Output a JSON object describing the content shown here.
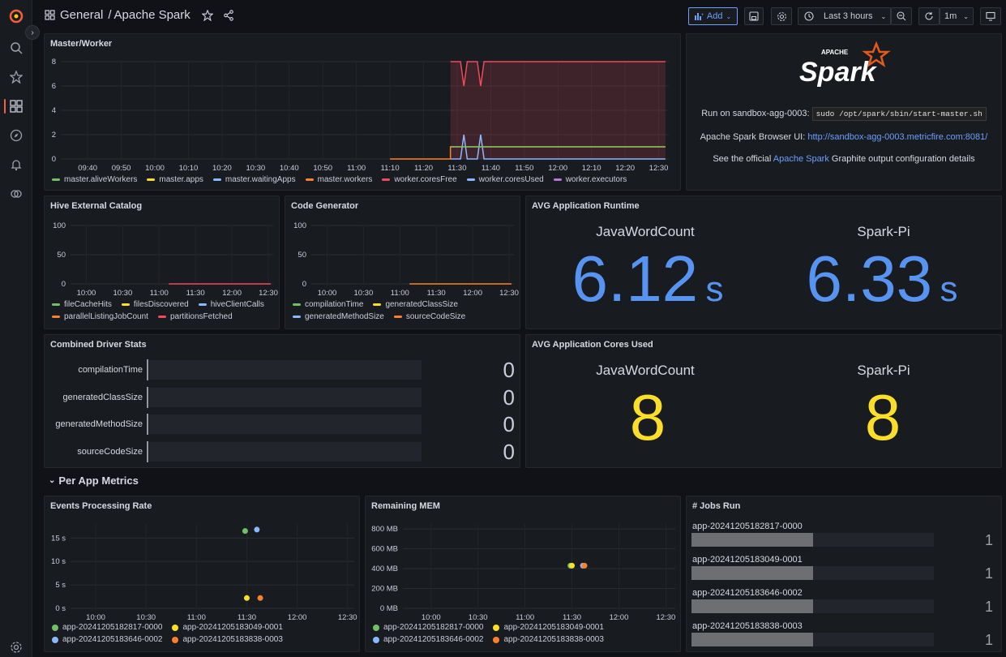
{
  "topbar": {
    "breadcrumb_folder": "General",
    "breadcrumb_sep": "/",
    "breadcrumb_dashboard": "Apache Spark",
    "add_label": "Add",
    "time_range": "Last 3 hours",
    "refresh_interval": "1m"
  },
  "colors": {
    "green": "#73bf69",
    "yellow": "#fade2a",
    "blue": "#8ab8ff",
    "orange": "#ff7f2a",
    "red": "#f2495c",
    "purple": "#b877d9",
    "stat_blue": "#5794f2",
    "stat_yellow": "#fade2a",
    "accent": "#f55f3e"
  },
  "master_worker": {
    "title": "Master/Worker",
    "legend": [
      "master.aliveWorkers",
      "master.apps",
      "master.waitingApps",
      "master.workers",
      "worker.coresFree",
      "worker.coresUsed",
      "worker.executors"
    ]
  },
  "info_panel": {
    "logo_small": "APACHE",
    "logo_big": "Spark",
    "line1_prefix": "Run on sandbox-agg-0003:",
    "line1_code": "sudo /opt/spark/sbin/start-master.sh",
    "line2_prefix": "Apache Spark Browser UI:",
    "line2_link": "http://sandbox-agg-0003.metricfire.com:8081/",
    "line3_prefix": "See the official",
    "line3_link": "Apache Spark",
    "line3_suffix": "Graphite output configuration details"
  },
  "hive": {
    "title": "Hive External Catalog",
    "legend": [
      "fileCacheHits",
      "filesDiscovered",
      "hiveClientCalls",
      "parallelListingJobCount",
      "partitionsFetched"
    ]
  },
  "codegen": {
    "title": "Code Generator",
    "legend": [
      "compilationTime",
      "generatedClassSize",
      "generatedMethodSize",
      "sourceCodeSize"
    ]
  },
  "avg_runtime": {
    "title": "AVG Application Runtime",
    "items": [
      {
        "name": "JavaWordCount",
        "value": "6.12",
        "unit": "s"
      },
      {
        "name": "Spark-Pi",
        "value": "6.33",
        "unit": "s"
      }
    ]
  },
  "driver_stats": {
    "title": "Combined Driver Stats",
    "rows": [
      {
        "label": "compilationTime",
        "value": "0"
      },
      {
        "label": "generatedClassSize",
        "value": "0"
      },
      {
        "label": "generatedMethodSize",
        "value": "0"
      },
      {
        "label": "sourceCodeSize",
        "value": "0"
      }
    ]
  },
  "avg_cores": {
    "title": "AVG Application Cores Used",
    "items": [
      {
        "name": "JavaWordCount",
        "value": "8"
      },
      {
        "name": "Spark-Pi",
        "value": "8"
      }
    ]
  },
  "row_per_app": {
    "title": "Per App Metrics"
  },
  "events": {
    "title": "Events Processing Rate",
    "legend": [
      "app-20241205182817-0000",
      "app-20241205183049-0001",
      "app-20241205183646-0002",
      "app-20241205183838-0003"
    ]
  },
  "remaining_mem": {
    "title": "Remaining MEM",
    "legend": [
      "app-20241205182817-0000",
      "app-20241205183049-0001",
      "app-20241205183646-0002",
      "app-20241205183838-0003"
    ]
  },
  "jobs_run": {
    "title": "# Jobs Run",
    "rows": [
      {
        "label": "app-20241205182817-0000",
        "value": "1",
        "fill": 0.5
      },
      {
        "label": "app-20241205183049-0001",
        "value": "1",
        "fill": 0.5
      },
      {
        "label": "app-20241205183646-0002",
        "value": "1",
        "fill": 0.5
      },
      {
        "label": "app-20241205183838-0003",
        "value": "1",
        "fill": 0.5
      }
    ]
  },
  "chart_data": [
    {
      "type": "line",
      "title": "Master/Worker",
      "x": [
        "09:40",
        "09:50",
        "10:00",
        "10:10",
        "10:20",
        "10:30",
        "10:40",
        "10:50",
        "11:00",
        "11:10",
        "11:20",
        "11:30",
        "11:40",
        "11:50",
        "12:00",
        "12:10",
        "12:20",
        "12:30"
      ],
      "yticks": [
        0,
        2,
        4,
        6,
        8
      ],
      "ylim": [
        0,
        8
      ],
      "series": [
        {
          "name": "worker.coresFree",
          "points": [
            [
              "11:28",
              8
            ],
            [
              "11:31",
              8
            ],
            [
              "11:32",
              6
            ],
            [
              "11:33",
              8
            ],
            [
              "11:36",
              8
            ],
            [
              "11:37",
              6
            ],
            [
              "11:38",
              8
            ],
            [
              "12:32",
              8
            ]
          ]
        },
        {
          "name": "worker.coresUsed",
          "points": [
            [
              "11:28",
              0
            ],
            [
              "11:31",
              0
            ],
            [
              "11:32",
              2
            ],
            [
              "11:33",
              0
            ],
            [
              "11:36",
              0
            ],
            [
              "11:37",
              2
            ],
            [
              "11:38",
              0
            ],
            [
              "12:32",
              0
            ]
          ]
        },
        {
          "name": "master.workers",
          "points": [
            [
              "11:10",
              0
            ],
            [
              "11:28",
              0
            ],
            [
              "11:28",
              1
            ],
            [
              "12:32",
              1
            ]
          ]
        },
        {
          "name": "master.aliveWorkers",
          "points": [
            [
              "11:28",
              1
            ],
            [
              "12:32",
              1
            ]
          ]
        }
      ]
    },
    {
      "type": "line",
      "title": "Hive External Catalog",
      "x": [
        "10:00",
        "10:30",
        "11:00",
        "11:30",
        "12:00",
        "12:30"
      ],
      "yticks": [
        0,
        50,
        100
      ],
      "ylim": [
        0,
        100
      ],
      "series": [
        {
          "name": "partitionsFetched",
          "points": [
            [
              "11:08",
              0
            ],
            [
              "12:32",
              0
            ]
          ]
        }
      ]
    },
    {
      "type": "line",
      "title": "Code Generator",
      "x": [
        "10:00",
        "10:30",
        "11:00",
        "11:30",
        "12:00",
        "12:30"
      ],
      "yticks": [
        0,
        50,
        100
      ],
      "ylim": [
        0,
        100
      ],
      "series": [
        {
          "name": "sourceCodeSize",
          "points": [
            [
              "11:08",
              0
            ],
            [
              "12:32",
              0
            ]
          ]
        }
      ]
    },
    {
      "type": "scatter",
      "title": "Events Processing Rate",
      "x": [
        "10:00",
        "10:30",
        "11:00",
        "11:30",
        "12:00",
        "12:30"
      ],
      "yticks": [
        "0 s",
        "5 s",
        "10 s",
        "15 s"
      ],
      "ylim": [
        0,
        18
      ],
      "series": [
        {
          "name": "app-20241205182817-0000",
          "points": [
            [
              "11:29",
              16.5
            ]
          ]
        },
        {
          "name": "app-20241205183049-0001",
          "points": [
            [
              "11:30",
              2.2
            ]
          ]
        },
        {
          "name": "app-20241205183646-0002",
          "points": [
            [
              "11:36",
              16.8
            ]
          ]
        },
        {
          "name": "app-20241205183838-0003",
          "points": [
            [
              "11:38",
              2.2
            ]
          ]
        }
      ]
    },
    {
      "type": "scatter",
      "title": "Remaining MEM",
      "x": [
        "10:00",
        "10:30",
        "11:00",
        "11:30",
        "12:00",
        "12:30"
      ],
      "yticks": [
        "0 MB",
        "200 MB",
        "400 MB",
        "600 MB",
        "800 MB"
      ],
      "ylim": [
        0,
        850
      ],
      "series": [
        {
          "name": "app-20241205182817-0000",
          "points": [
            [
              "11:29",
              430
            ]
          ]
        },
        {
          "name": "app-20241205183049-0001",
          "points": [
            [
              "11:30",
              430
            ]
          ]
        },
        {
          "name": "app-20241205183646-0002",
          "points": [
            [
              "11:37",
              430
            ]
          ]
        },
        {
          "name": "app-20241205183838-0003",
          "points": [
            [
              "11:38",
              430
            ]
          ]
        }
      ]
    }
  ]
}
